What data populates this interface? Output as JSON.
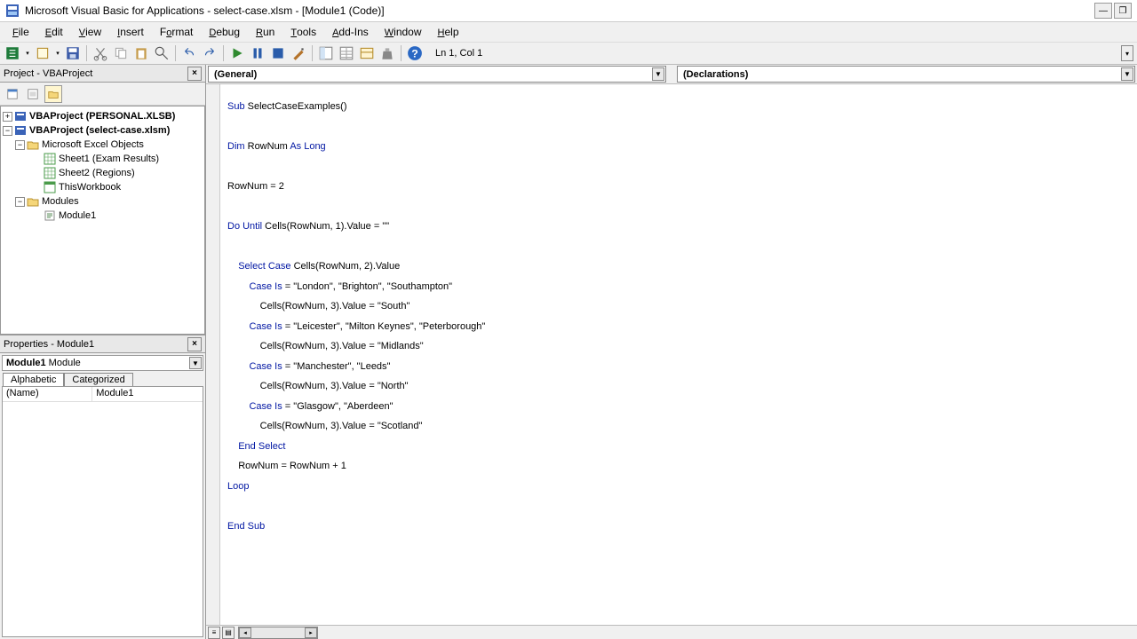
{
  "title": "Microsoft Visual Basic for Applications - select-case.xlsm - [Module1 (Code)]",
  "menu": {
    "file": "File",
    "edit": "Edit",
    "view": "View",
    "insert": "Insert",
    "format": "Format",
    "debug": "Debug",
    "run": "Run",
    "tools": "Tools",
    "addins": "Add-Ins",
    "window": "Window",
    "help": "Help"
  },
  "status": "Ln 1, Col 1",
  "project_panel": {
    "title": "Project - VBAProject",
    "tree": {
      "p1": "VBAProject (PERSONAL.XLSB)",
      "p2": "VBAProject (select-case.xlsm)",
      "f1": "Microsoft Excel Objects",
      "s1": "Sheet1 (Exam Results)",
      "s2": "Sheet2 (Regions)",
      "tw": "ThisWorkbook",
      "f2": "Modules",
      "m1": "Module1"
    }
  },
  "properties_panel": {
    "title": "Properties - Module1",
    "object_bold": "Module1",
    "object_type": " Module",
    "tabs": {
      "alpha": "Alphabetic",
      "cat": "Categorized"
    },
    "name_key": "(Name)",
    "name_val": "Module1"
  },
  "code_dropdowns": {
    "left": "(General)",
    "right": "(Declarations)"
  },
  "code": {
    "l1a": "Sub",
    "l1b": " SelectCaseExamples()",
    "l2a": "Dim",
    "l2b": " RowNum ",
    "l2c": "As Long",
    "l3": "RowNum = 2",
    "l4a": "Do Until",
    "l4b": " Cells(RowNum, 1).Value = \"\"",
    "l5a": "    Select Case",
    "l5b": " Cells(RowNum, 2).Value",
    "l6a": "        Case Is",
    "l6b": " = \"London\", \"Brighton\", \"Southampton\"",
    "l7": "            Cells(RowNum, 3).Value = \"South\"",
    "l8a": "        Case Is",
    "l8b": " = \"Leicester\", \"Milton Keynes\", \"Peterborough\"",
    "l9": "            Cells(RowNum, 3).Value = \"Midlands\"",
    "l10a": "        Case Is",
    "l10b": " = \"Manchester\", \"Leeds\"",
    "l11": "            Cells(RowNum, 3).Value = \"North\"",
    "l12a": "        Case Is",
    "l12b": " = \"Glasgow\", \"Aberdeen\"",
    "l13": "            Cells(RowNum, 3).Value = \"Scotland\"",
    "l14": "    End Select",
    "l15": "    RowNum = RowNum + 1",
    "l16": "Loop",
    "l17a": "End Sub"
  }
}
